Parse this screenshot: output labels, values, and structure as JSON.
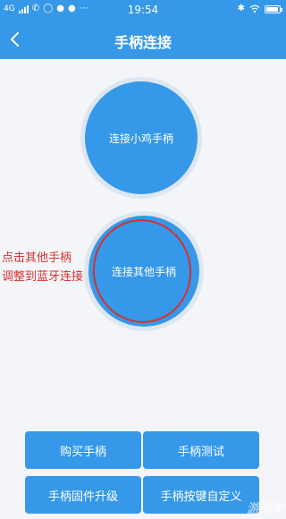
{
  "status_bar": {
    "network": "4G",
    "time": "19:54",
    "battery_level": 0.9
  },
  "header": {
    "title": "手柄连接",
    "back_icon": "chevron-left-icon"
  },
  "main": {
    "connect_xiaoji_label": "连接小鸡手柄",
    "connect_other_label": "连接其他手柄"
  },
  "annotation": {
    "line1": "点击其他手柄",
    "line2": "调整到蓝牙连接",
    "color": "#d8302f"
  },
  "bottom": {
    "buy_label": "购买手柄",
    "test_label": "手柄测试",
    "firmware_label": "手柄固件升级",
    "custom_keys_label": "手柄按键自定义"
  },
  "watermark": "游戏狗",
  "colors": {
    "accent": "#3598e8",
    "background": "#f3f5f8"
  }
}
